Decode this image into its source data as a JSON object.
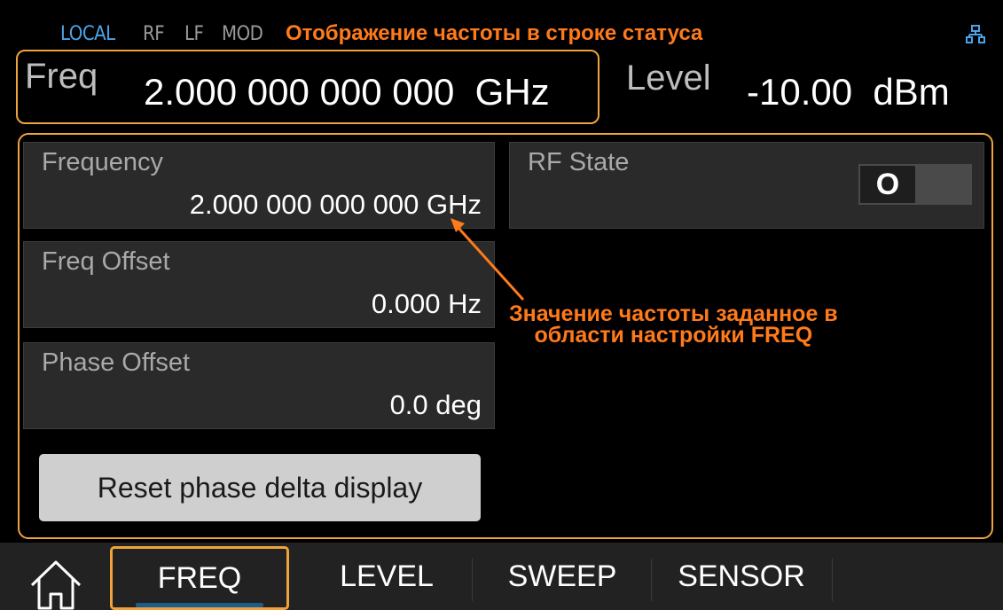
{
  "status_bar": {
    "local": "LOCAL",
    "rf": "RF",
    "lf": "LF",
    "mod": "MOD",
    "annotation": "Отображение частоты в строке статуса",
    "network_icon": "network-icon"
  },
  "header": {
    "freq_label": "Freq",
    "freq_value": "2.000 000 000 000  GHz",
    "level_label": "Level",
    "level_value": "-10.00  dBm"
  },
  "panels": {
    "frequency": {
      "title": "Frequency",
      "value": "2.000 000 000 000 GHz"
    },
    "freq_offset": {
      "title": "Freq Offset",
      "value": "0.000 Hz"
    },
    "phase_offset": {
      "title": "Phase Offset",
      "value": "0.0 deg"
    },
    "reset_button": "Reset phase delta display",
    "rf_state": {
      "title": "RF State",
      "toggle_value": "O"
    }
  },
  "annotation2": {
    "line1": "Значение частоты заданное в",
    "line2": "области настройки FREQ"
  },
  "nav": {
    "home_icon": "home-icon",
    "tabs": [
      "FREQ",
      "LEVEL",
      "SWEEP",
      "SENSOR"
    ],
    "active_tab": "FREQ"
  },
  "colors": {
    "accent_orange": "#f0a23c",
    "annotation_orange": "#ff7a1a",
    "local_blue": "#4aa3e8",
    "panel_bg": "#2a2a2a"
  }
}
